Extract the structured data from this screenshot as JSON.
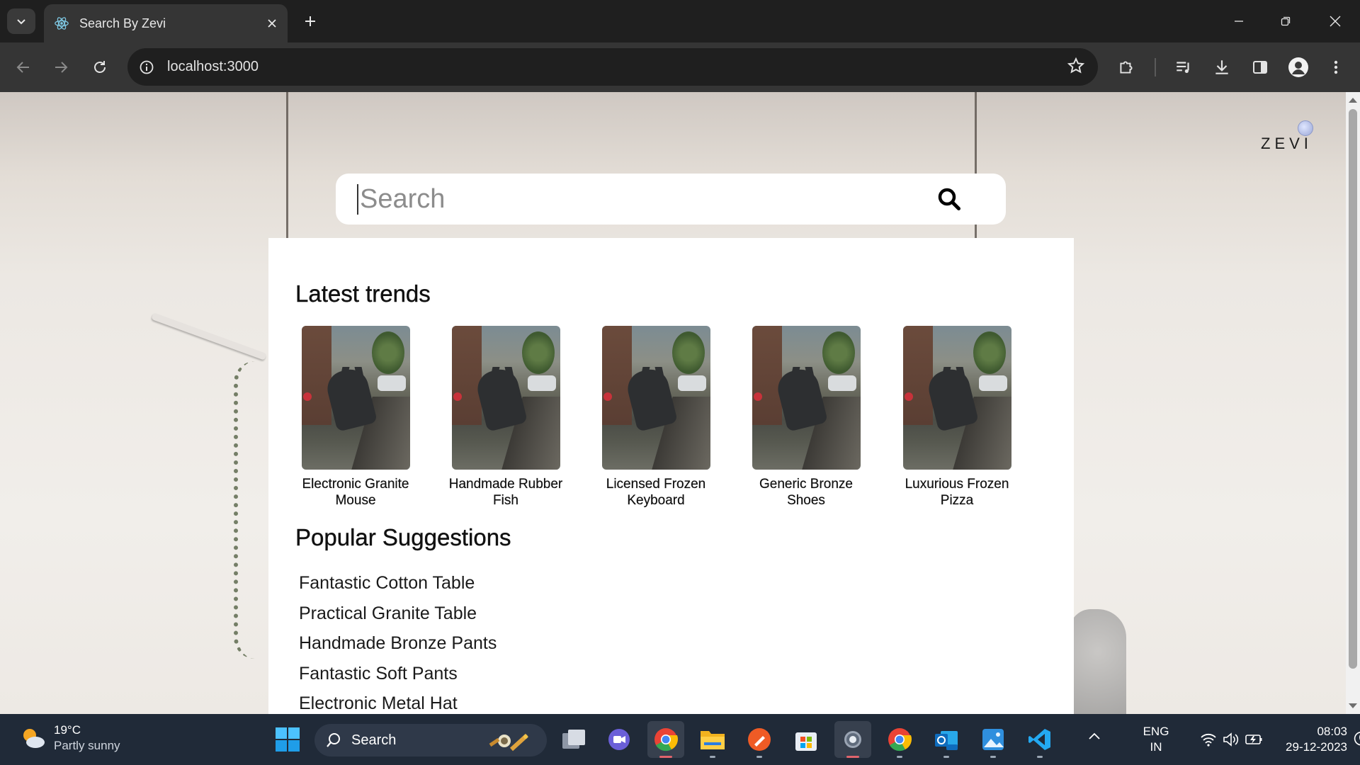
{
  "browser": {
    "tab_title": "Search By Zevi",
    "url": "localhost:3000"
  },
  "page": {
    "brand": "ZEVI",
    "search": {
      "placeholder": "Search",
      "value": ""
    },
    "trends_title": "Latest trends",
    "trends": [
      {
        "name": "Electronic Granite Mouse"
      },
      {
        "name": "Handmade Rubber Fish"
      },
      {
        "name": "Licensed Frozen Keyboard"
      },
      {
        "name": "Generic Bronze Shoes"
      },
      {
        "name": "Luxurious Frozen Pizza"
      }
    ],
    "suggestions_title": "Popular Suggestions",
    "suggestions": [
      "Fantastic Cotton Table",
      "Practical Granite Table",
      "Handmade Bronze Pants",
      "Fantastic Soft Pants",
      "Electronic Metal Hat"
    ]
  },
  "taskbar": {
    "weather_temp": "19°C",
    "weather_condition": "Partly sunny",
    "search_label": "Search",
    "language": "ENG",
    "region": "IN",
    "time": "08:03",
    "date": "29-12-2023"
  },
  "colors": {
    "browser_frame": "#1f1f1f",
    "toolbar": "#353535",
    "taskbar": "#202a38",
    "panel": "#ffffff"
  }
}
